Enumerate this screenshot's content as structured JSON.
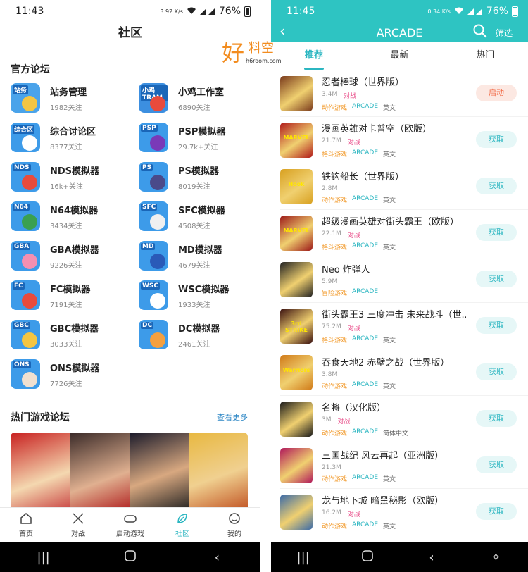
{
  "left": {
    "status": {
      "time": "11:43",
      "net": "3.92 K/s",
      "battery": "76%"
    },
    "title": "社区",
    "official_title": "官方论坛",
    "forums": [
      {
        "tag": "站务",
        "name": "站务管理",
        "count": "1982关注",
        "color": "#4aa3ea"
      },
      {
        "tag": "小鸡TRAM",
        "name": "小鸡工作室",
        "count": "6890关注",
        "color": "#3c8fe0"
      },
      {
        "tag": "综合区",
        "name": "综合讨论区",
        "count": "8377关注",
        "color": "#3d9be9"
      },
      {
        "tag": "PSP",
        "name": "PSP模拟器",
        "count": "29.7k+关注",
        "color": "#3d9be9"
      },
      {
        "tag": "NDS",
        "name": "NDS模拟器",
        "count": "16k+关注",
        "color": "#3d9be9"
      },
      {
        "tag": "PS",
        "name": "PS模拟器",
        "count": "8019关注",
        "color": "#3d9be9"
      },
      {
        "tag": "N64",
        "name": "N64模拟器",
        "count": "3434关注",
        "color": "#3d9be9"
      },
      {
        "tag": "SFC",
        "name": "SFC模拟器",
        "count": "4508关注",
        "color": "#3d9be9"
      },
      {
        "tag": "GBA",
        "name": "GBA模拟器",
        "count": "9226关注",
        "color": "#3d9be9"
      },
      {
        "tag": "MD",
        "name": "MD模拟器",
        "count": "4679关注",
        "color": "#3d9be9"
      },
      {
        "tag": "FC",
        "name": "FC模拟器",
        "count": "7191关注",
        "color": "#3d9be9"
      },
      {
        "tag": "WSC",
        "name": "WSC模拟器",
        "count": "1933关注",
        "color": "#3d9be9"
      },
      {
        "tag": "GBC",
        "name": "GBC模拟器",
        "count": "3033关注",
        "color": "#3d9be9"
      },
      {
        "tag": "DC",
        "name": "DC模拟器",
        "count": "2461关注",
        "color": "#3d9be9"
      },
      {
        "tag": "ONS",
        "name": "ONS模拟器",
        "count": "7726关注",
        "color": "#3d9be9"
      }
    ],
    "hot_title": "热门游戏论坛",
    "hot_more": "查看更多",
    "tabs": [
      "首页",
      "对战",
      "启动游戏",
      "社区",
      "我的"
    ]
  },
  "watermark": {
    "big": "好",
    "small": "料空",
    "url": "h6room.com"
  },
  "right": {
    "status": {
      "time": "11:45",
      "net": "0.34 K/s",
      "battery": "76%"
    },
    "title": "ARCADE",
    "filter": "筛选",
    "subtabs": [
      "推荐",
      "最新",
      "热门"
    ],
    "games": [
      {
        "name": "忍者棒球（世界版）",
        "size": "3.4M",
        "vs": "对战",
        "genre": "动作游戏",
        "plat": "ARCADE",
        "lang": "英文",
        "btn": "启动",
        "launch": true,
        "thumb": "#7a3a1c"
      },
      {
        "name": "漫画英雄对卡普空（欧版）",
        "size": "21.7M",
        "vs": "对战",
        "genre": "格斗游戏",
        "plat": "ARCADE",
        "lang": "英文",
        "btn": "获取",
        "launch": false,
        "thumb": "#b01a1a",
        "thumb_text": "MARVEL"
      },
      {
        "name": "铁钩船长（世界版）",
        "size": "2.8M",
        "vs": "",
        "genre": "动作游戏",
        "plat": "ARCADE",
        "lang": "英文",
        "btn": "获取",
        "launch": false,
        "thumb": "#d8a020",
        "thumb_text": "Hook"
      },
      {
        "name": "超级漫画英雄对街头霸王（欧版）",
        "size": "22.1M",
        "vs": "对战",
        "genre": "格斗游戏",
        "plat": "ARCADE",
        "lang": "英文",
        "btn": "获取",
        "launch": false,
        "thumb": "#9c1818",
        "thumb_text": "MARVEL"
      },
      {
        "name": "Neo 炸弹人",
        "size": "5.9M",
        "vs": "",
        "genre": "冒险游戏",
        "plat": "ARCADE",
        "lang": "",
        "btn": "获取",
        "launch": false,
        "thumb": "#222222"
      },
      {
        "name": "街头霸王3 三度冲击 未来战斗（世...",
        "size": "75.2M",
        "vs": "对战",
        "genre": "格斗游戏",
        "plat": "ARCADE",
        "lang": "英文",
        "btn": "获取",
        "launch": false,
        "thumb": "#3a1010",
        "thumb_text": "3rd STRIKE"
      },
      {
        "name": "吞食天地2 赤壁之战（世界版）",
        "size": "3.8M",
        "vs": "",
        "genre": "动作游戏",
        "plat": "ARCADE",
        "lang": "英文",
        "btn": "获取",
        "launch": false,
        "thumb": "#d07a18",
        "thumb_text": "Warriors"
      },
      {
        "name": "名将（汉化版）",
        "size": "3M",
        "vs": "对战",
        "genre": "动作游戏",
        "plat": "ARCADE",
        "lang": "简体中文",
        "btn": "获取",
        "launch": false,
        "thumb": "#1a1a1a"
      },
      {
        "name": "三国战纪 风云再起（亚洲版）",
        "size": "21.3M",
        "vs": "",
        "genre": "动作游戏",
        "plat": "ARCADE",
        "lang": "英文",
        "btn": "获取",
        "launch": false,
        "thumb": "#b0185a"
      },
      {
        "name": "龙与地下城 暗黑秘影（欧版）",
        "size": "16.2M",
        "vs": "对战",
        "genre": "动作游戏",
        "plat": "ARCADE",
        "lang": "英文",
        "btn": "获取",
        "launch": false,
        "thumb": "#3a6aa8"
      }
    ]
  }
}
